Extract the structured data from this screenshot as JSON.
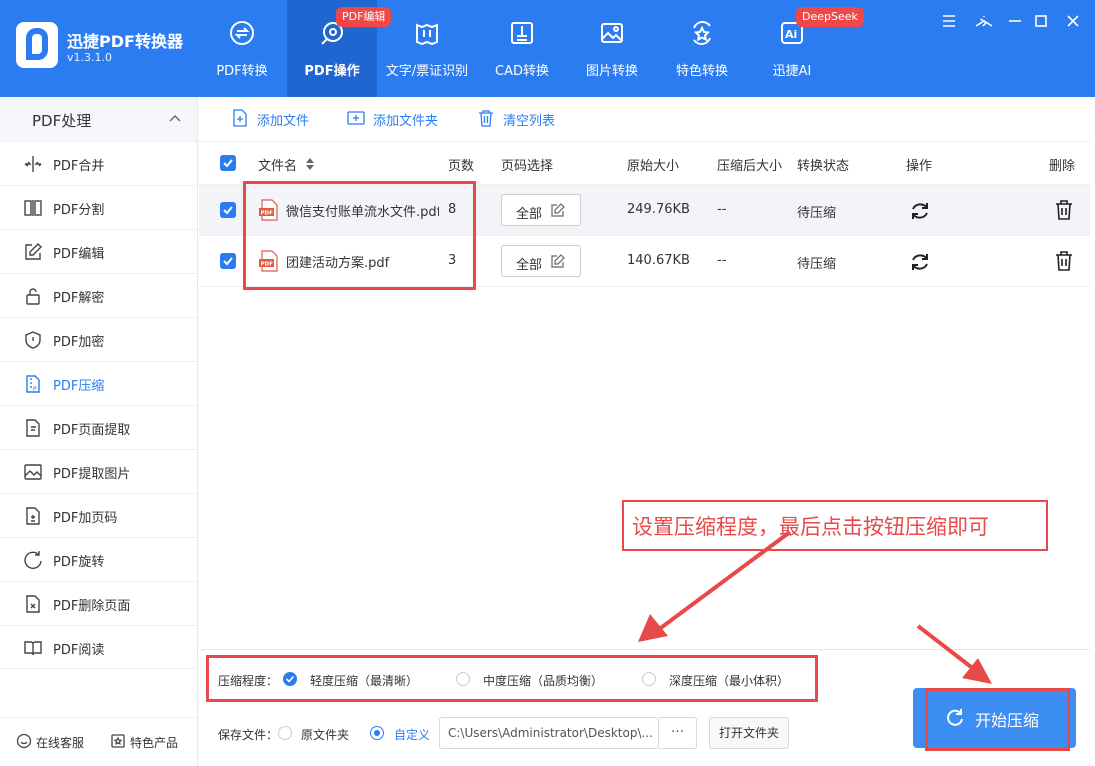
{
  "app": {
    "name": "迅捷PDF转换器",
    "version": "v1.3.1.0"
  },
  "nav": {
    "tabs": [
      {
        "label": "PDF转换"
      },
      {
        "label": "PDF操作",
        "badge": "PDF编辑"
      },
      {
        "label": "文字/票证识别"
      },
      {
        "label": "CAD转换"
      },
      {
        "label": "图片转换"
      },
      {
        "label": "特色转换"
      },
      {
        "label": "迅捷AI",
        "badge": "DeepSeek"
      }
    ]
  },
  "sidebar": {
    "header": "PDF处理",
    "items": [
      {
        "label": "PDF合并",
        "icon": "merge-icon"
      },
      {
        "label": "PDF分割",
        "icon": "split-icon"
      },
      {
        "label": "PDF编辑",
        "icon": "edit-icon"
      },
      {
        "label": "PDF解密",
        "icon": "unlock-icon"
      },
      {
        "label": "PDF加密",
        "icon": "shield-icon"
      },
      {
        "label": "PDF压缩",
        "icon": "compress-icon"
      },
      {
        "label": "PDF页面提取",
        "icon": "extract-page-icon"
      },
      {
        "label": "PDF提取图片",
        "icon": "image-icon"
      },
      {
        "label": "PDF加页码",
        "icon": "page-number-icon"
      },
      {
        "label": "PDF旋转",
        "icon": "rotate-icon"
      },
      {
        "label": "PDF删除页面",
        "icon": "delete-page-icon"
      },
      {
        "label": "PDF阅读",
        "icon": "book-icon"
      }
    ],
    "active": "PDF压缩",
    "bottom": {
      "service": "在线客服",
      "products": "特色产品"
    }
  },
  "toolbar": {
    "add_file": "添加文件",
    "add_folder": "添加文件夹",
    "clear_list": "清空列表"
  },
  "table": {
    "headers": {
      "filename": "文件名",
      "pages": "页数",
      "page_select": "页码选择",
      "orig_size": "原始大小",
      "new_size": "压缩后大小",
      "status": "转换状态",
      "op": "操作",
      "delete": "删除"
    },
    "rows": [
      {
        "filename": "微信支付账单流水文件.pdf",
        "pages": "8",
        "page_select": "全部",
        "orig_size": "249.76KB",
        "new_size": "--",
        "status": "待压缩"
      },
      {
        "filename": "团建活动方案.pdf",
        "pages": "3",
        "page_select": "全部",
        "orig_size": "140.67KB",
        "new_size": "--",
        "status": "待压缩"
      }
    ]
  },
  "compression": {
    "label": "压缩程度：",
    "options": [
      {
        "label": "轻度压缩（最清晰）",
        "selected": true
      },
      {
        "label": "中度压缩（品质均衡）",
        "selected": false
      },
      {
        "label": "深度压缩（最小体积）",
        "selected": false
      }
    ]
  },
  "save": {
    "label": "保存文件：",
    "opt_original": "原文件夹",
    "opt_custom": "自定义",
    "path": "C:\\Users\\Administrator\\Desktop\\...",
    "dots": "···",
    "open_folder": "打开文件夹"
  },
  "start_button": "开始压缩",
  "annotation": "设置压缩程度，最后点击按钮压缩即可",
  "colors": {
    "primary": "#2b7cf0",
    "annotation_red": "#e84a4a",
    "badge_red": "#f04848"
  }
}
